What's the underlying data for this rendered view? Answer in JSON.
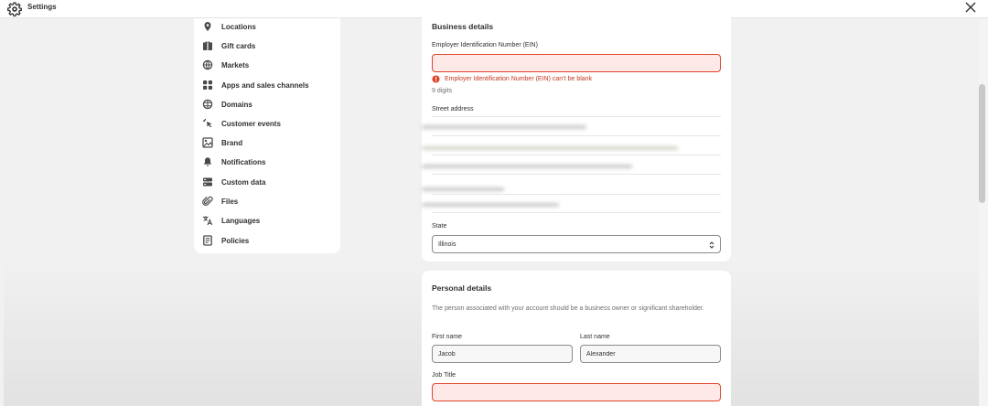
{
  "window": {
    "title": "Settings",
    "title_icon": "gear-icon",
    "close_icon": "close-icon"
  },
  "sidebar": {
    "items": [
      {
        "label": "Locations",
        "icon": "location-pin-icon"
      },
      {
        "label": "Gift cards",
        "icon": "gift-card-icon"
      },
      {
        "label": "Markets",
        "icon": "globe-icon"
      },
      {
        "label": "Apps and sales channels",
        "icon": "apps-icon"
      },
      {
        "label": "Domains",
        "icon": "domains-globe-icon"
      },
      {
        "label": "Customer events",
        "icon": "cursor-click-icon"
      },
      {
        "label": "Brand",
        "icon": "brand-image-icon"
      },
      {
        "label": "Notifications",
        "icon": "bell-icon"
      },
      {
        "label": "Custom data",
        "icon": "custom-data-icon"
      },
      {
        "label": "Files",
        "icon": "paperclip-icon"
      },
      {
        "label": "Languages",
        "icon": "translate-icon"
      },
      {
        "label": "Policies",
        "icon": "policy-document-icon"
      }
    ]
  },
  "business": {
    "heading": "Business details",
    "ein_label": "Employer Identification Number (EIN)",
    "ein_value": "",
    "ein_error": "Employer Identification Number (EIN) can’t be blank",
    "ein_help": "9 digits",
    "street_label": "Street address",
    "state_label": "State",
    "state_value": "Illinois"
  },
  "personal": {
    "heading": "Personal details",
    "description": "The person associated with your account should be a business owner or significant shareholder.",
    "first_name_label": "First name",
    "first_name_value": "Jacob",
    "last_name_label": "Last name",
    "last_name_value": "Alexander",
    "job_title_label": "Job Title",
    "job_title_value": ""
  },
  "colors": {
    "error": "#e0442b",
    "error_bg": "#fee9e8",
    "page_bg": "#f1f1f1",
    "card_bg": "#ffffff"
  }
}
